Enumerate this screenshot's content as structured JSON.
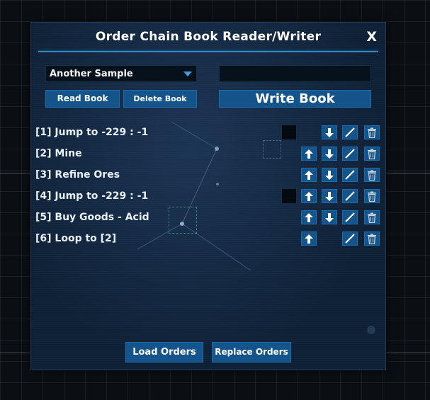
{
  "dialog": {
    "title": "Order Chain Book Reader/Writer",
    "close_label": "X"
  },
  "book_select": {
    "selected": "Another Sample"
  },
  "book_name_input": {
    "value": "",
    "placeholder": ""
  },
  "buttons": {
    "read_book": "Read Book",
    "delete_book": "Delete Book",
    "write_book": "Write Book",
    "load_orders": "Load Orders",
    "replace_orders": "Replace Orders"
  },
  "orders": [
    {
      "label": "[1] Jump to -229 : -1",
      "has_marker": true,
      "has_up": false,
      "has_down": true
    },
    {
      "label": "[2] Mine",
      "has_marker": false,
      "has_up": true,
      "has_down": true
    },
    {
      "label": "[3] Refine Ores",
      "has_marker": false,
      "has_up": true,
      "has_down": true
    },
    {
      "label": "[4] Jump to -229 : -1",
      "has_marker": true,
      "has_up": true,
      "has_down": true
    },
    {
      "label": "[5] Buy Goods - Acid",
      "has_marker": false,
      "has_up": true,
      "has_down": true
    },
    {
      "label": "[6] Loop to [2]",
      "has_marker": false,
      "has_up": true,
      "has_down": false
    }
  ],
  "icons": {
    "move_up": "arrow-up-icon",
    "move_down": "arrow-down-icon",
    "edit": "edit-pencil-icon",
    "delete": "trash-icon"
  },
  "colors": {
    "accent": "#3aa0e0",
    "button_bg": "#14548a",
    "panel_bg": "#0e2036"
  }
}
